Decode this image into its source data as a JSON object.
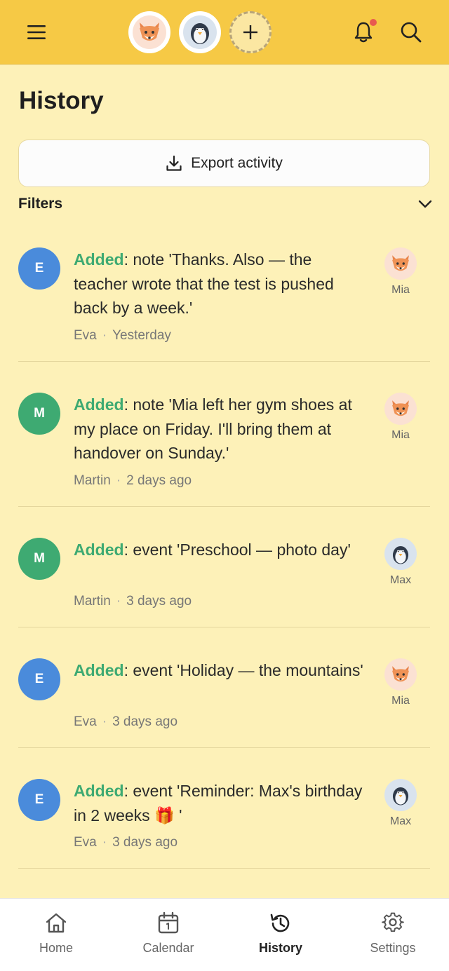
{
  "header": {
    "menu_icon": "hamburger-icon",
    "kids": [
      {
        "name": "Mia",
        "icon": "fox-icon"
      },
      {
        "name": "Max",
        "icon": "penguin-icon"
      }
    ],
    "add_kid_icon": "plus-icon",
    "notifications_icon": "bell-icon",
    "search_icon": "search-icon",
    "colors": {
      "bar": "#f6c945",
      "background": "#fdf1b8",
      "notification_dot": "#e85a4f"
    }
  },
  "page": {
    "title": "History",
    "export_label": "Export activity",
    "export_icon": "download-icon",
    "filters_label": "Filters",
    "filters_icon": "chevron-down-icon"
  },
  "activities": [
    {
      "initial": "E",
      "avatar_color": "#4a8bdb",
      "verb": "Added",
      "text": ": note 'Thanks. Also — the teacher wrote that the test is pushed back by a week.'",
      "author": "Eva",
      "time": "Yesterday",
      "child": "Mia",
      "child_icon": "fox-icon"
    },
    {
      "initial": "M",
      "avatar_color": "#3eaa72",
      "verb": "Added",
      "text": ": note 'Mia left her gym shoes at my place on Friday. I'll bring them at handover on Sunday.'",
      "author": "Martin",
      "time": "2 days ago",
      "child": "Mia",
      "child_icon": "fox-icon"
    },
    {
      "initial": "M",
      "avatar_color": "#3eaa72",
      "verb": "Added",
      "text": ": event 'Preschool — photo day'",
      "author": "Martin",
      "time": "3 days ago",
      "child": "Max",
      "child_icon": "penguin-icon"
    },
    {
      "initial": "E",
      "avatar_color": "#4a8bdb",
      "verb": "Added",
      "text": ": event 'Holiday — the mountains'",
      "author": "Eva",
      "time": "3 days ago",
      "child": "Mia",
      "child_icon": "fox-icon"
    },
    {
      "initial": "E",
      "avatar_color": "#4a8bdb",
      "verb": "Added",
      "text": ": event 'Reminder: Max's birthday in 2 weeks 🎁 '",
      "author": "Eva",
      "time": "3 days ago",
      "child": "Max",
      "child_icon": "penguin-icon"
    }
  ],
  "nav": {
    "items": [
      {
        "label": "Home",
        "icon": "home-icon"
      },
      {
        "label": "Calendar",
        "icon": "calendar-icon"
      },
      {
        "label": "History",
        "icon": "history-icon",
        "active": true
      },
      {
        "label": "Settings",
        "icon": "gear-icon"
      }
    ]
  }
}
